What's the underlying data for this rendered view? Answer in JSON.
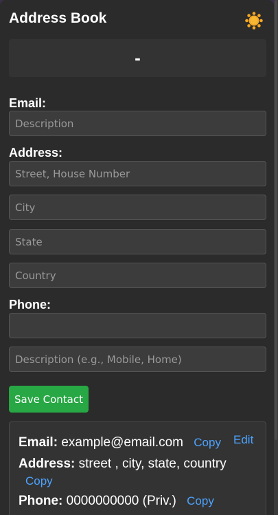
{
  "header": {
    "title": "Address Book"
  },
  "display": {
    "value": "-"
  },
  "form": {
    "email_label": "Email:",
    "email_description_placeholder": "Description",
    "address_label": "Address:",
    "street_placeholder": "Street, House Number",
    "city_placeholder": "City",
    "state_placeholder": "State",
    "country_placeholder": "Country",
    "phone_label": "Phone:",
    "phone_placeholder": "",
    "phone_description_placeholder": "Description (e.g., Mobile, Home)",
    "save_label": "Save Contact"
  },
  "contact": {
    "email_label": "Email:",
    "email_value": "example@email.com",
    "address_label": "Address:",
    "address_value": "street , city, state, country",
    "phone_label": "Phone:",
    "phone_value": "0000000000 (Priv.)",
    "copy_label": "Copy",
    "edit_label": "Edit"
  },
  "colors": {
    "accent_button": "#28a745",
    "link": "#4da3ff",
    "panel_bg": "#2b2b2b"
  },
  "icons": {
    "theme_toggle": "sun-icon"
  }
}
